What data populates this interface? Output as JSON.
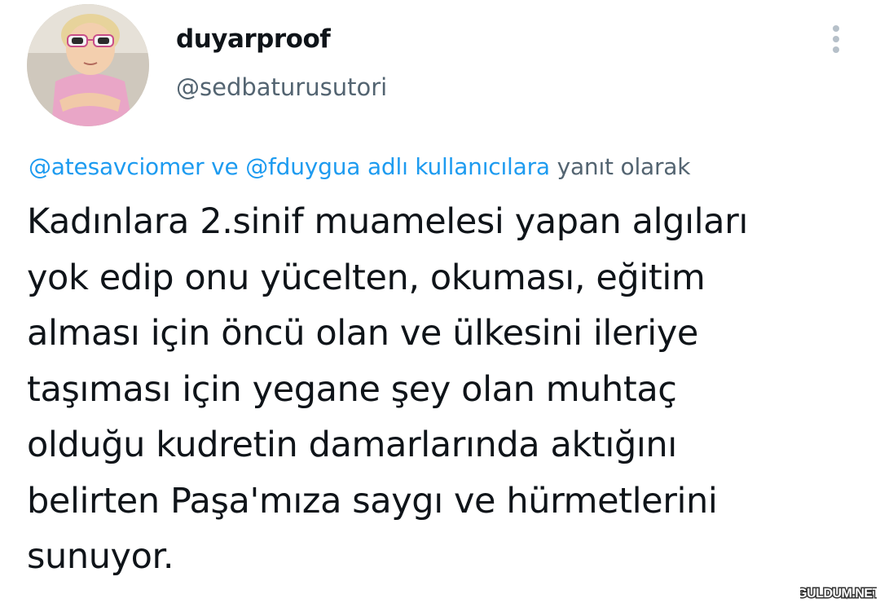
{
  "author": {
    "display_name": "duyarproof",
    "handle": "@sedbaturusutori"
  },
  "reply_context": {
    "mention_1": "@atesavciomer",
    "connector": "ve",
    "mention_2": "@fduygua",
    "suffix_link": "adlı kullanıcılara",
    "suffix_text": "yanıt olarak"
  },
  "tweet": {
    "lines": [
      "Kadınlara 2.sinif muamelesi yapan algıları",
      "yok edip onu yücelten, okuması, eğitim",
      "alması için öncü olan ve ülkesini ileriye",
      "taşıması için yegane şey olan muhtaç",
      "olduğu kudretin damarlarında aktığını",
      "belirten Paşa'mıza saygı ve hürmetlerini",
      "sunuyor."
    ]
  },
  "watermark": {
    "text": "GULDUM.NET"
  },
  "icons": {
    "more": "more-vertical-icon"
  },
  "colors": {
    "link": "#1d9bf0",
    "secondary_text": "#536471",
    "primary_text": "#0f1419"
  }
}
